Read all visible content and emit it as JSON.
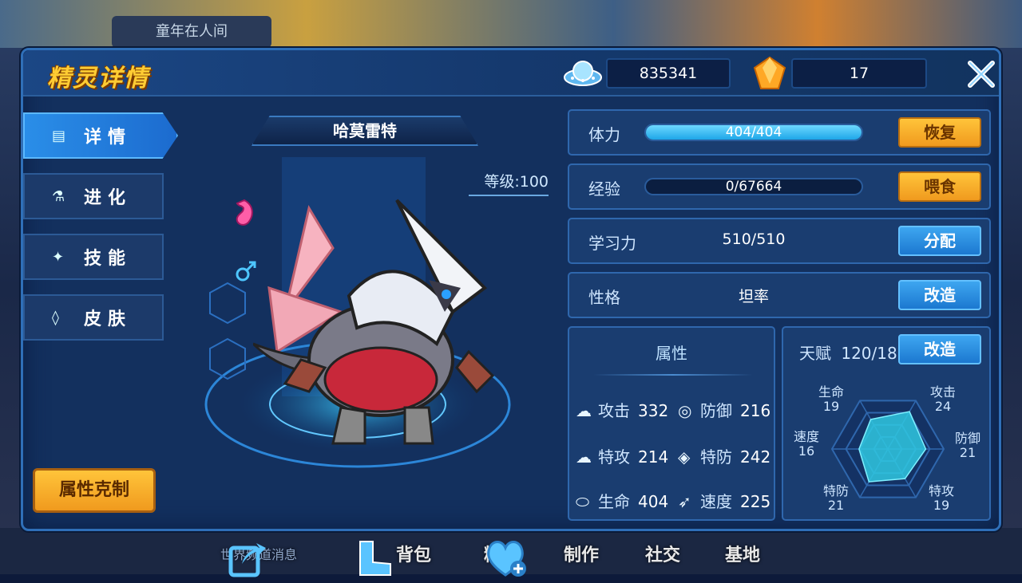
{
  "background": {
    "banner_text": "童年在人间",
    "nav_items": [
      "背包",
      "精灵",
      "制作",
      "社交",
      "基地"
    ],
    "chat_hint": "世界频道消息"
  },
  "header": {
    "title": "精灵详情",
    "currency1_value": "835341",
    "currency1_icon": "ufo-coin-icon",
    "currency2_value": "17",
    "currency2_icon": "gem-icon",
    "close_icon": "close-icon"
  },
  "tabs": [
    {
      "label": "详情",
      "icon": "detail-icon",
      "active": true
    },
    {
      "label": "进化",
      "icon": "flask-icon",
      "active": false
    },
    {
      "label": "技能",
      "icon": "skill-icon",
      "active": false
    },
    {
      "label": "皮肤",
      "icon": "drop-icon",
      "active": false
    }
  ],
  "attr_counter_button": "属性克制",
  "pet": {
    "name": "哈莫雷特",
    "level": "等级:100",
    "gender_icon": "male-icon",
    "element_icon": "dragon-element-icon"
  },
  "stats": {
    "hp": {
      "label": "体力",
      "value": "404/404",
      "fill": 1.0,
      "button": "恢复"
    },
    "exp": {
      "label": "经验",
      "value": "0/67664",
      "fill": 0.0,
      "button": "喂食"
    },
    "learn": {
      "label": "学习力",
      "value": "510/510",
      "button": "分配"
    },
    "nature": {
      "label": "性格",
      "value": "坦率",
      "button": "改造"
    }
  },
  "attributes": {
    "title": "属性",
    "items": [
      {
        "label": "攻击",
        "value": "332",
        "icon": "attack-icon"
      },
      {
        "label": "防御",
        "value": "216",
        "icon": "defense-icon"
      },
      {
        "label": "特攻",
        "value": "214",
        "icon": "sp-attack-icon"
      },
      {
        "label": "特防",
        "value": "242",
        "icon": "sp-defense-icon"
      },
      {
        "label": "生命",
        "value": "404",
        "icon": "hp-icon"
      },
      {
        "label": "速度",
        "value": "225",
        "icon": "speed-icon"
      }
    ]
  },
  "talent": {
    "label": "天赋",
    "value": "120/186",
    "button": "改造",
    "radar": [
      {
        "label": "生命",
        "value": "19"
      },
      {
        "label": "攻击",
        "value": "24"
      },
      {
        "label": "防御",
        "value": "21"
      },
      {
        "label": "特攻",
        "value": "19"
      },
      {
        "label": "特防",
        "value": "21"
      },
      {
        "label": "速度",
        "value": "16"
      }
    ],
    "radar_max": 31
  },
  "bottom_icons": [
    "share-icon",
    "boot-icon",
    "heart-plus-icon"
  ],
  "colors": {
    "accent_orange": "#f0a020",
    "accent_blue": "#1c78d0",
    "panel": "#13305e",
    "title_gold": "#ffcc33"
  }
}
